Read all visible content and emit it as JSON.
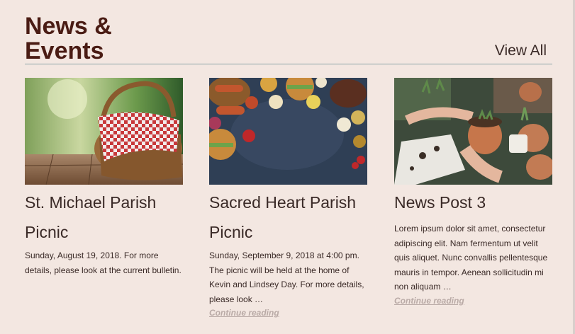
{
  "section": {
    "title": "News &\nEvents",
    "view_all": "View All"
  },
  "cards": [
    {
      "image": "picnic-basket-photo",
      "title": "St. Michael Parish Picnic",
      "text": "Sunday, August 19, 2018. For more details, please look at the current bulletin.",
      "continue": ""
    },
    {
      "image": "bbq-food-table-photo",
      "title": "Sacred Heart Parish Picnic",
      "text": "Sunday, September 9, 2018 at 4:00 pm. The picnic will be held at the home of Kevin and Lindsey Day. For more details, please look …",
      "continue": "Continue reading"
    },
    {
      "image": "potting-plants-photo",
      "title": "News Post 3",
      "text": "Lorem ipsum dolor sit amet, consectetur adipiscing elit. Nam fermentum ut velit quis aliquet. Nunc convallis pellentesque mauris in tempor. Aenean sollicitudin mi non aliquam …",
      "continue": "Continue reading"
    }
  ],
  "colors": {
    "background": "#f3e7e1",
    "title": "#4a1c14",
    "divider": "#8aa4a6",
    "continue_link": "#b9aaa6"
  }
}
